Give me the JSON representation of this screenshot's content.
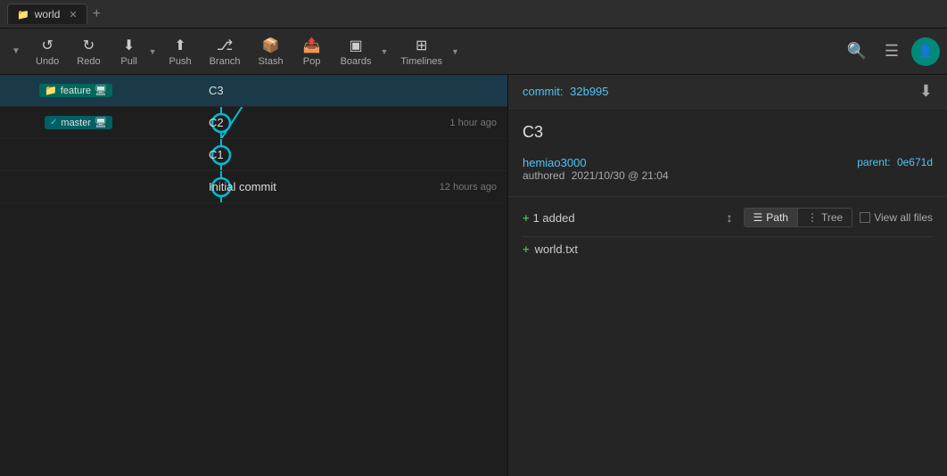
{
  "titlebar": {
    "tab_name": "world",
    "tab_icon": "📁",
    "new_tab_label": "+"
  },
  "toolbar": {
    "undo_label": "Undo",
    "redo_label": "Redo",
    "pull_label": "Pull",
    "push_label": "Push",
    "branch_label": "Branch",
    "stash_label": "Stash",
    "pop_label": "Pop",
    "boards_label": "Boards",
    "timelines_label": "Timelines"
  },
  "commits": [
    {
      "id": "c3",
      "message": "C3",
      "branch": "feature",
      "time": "",
      "selected": true
    },
    {
      "id": "c2",
      "message": "C2",
      "branch": "master",
      "time": "1 hour ago",
      "selected": false
    },
    {
      "id": "c1",
      "message": "C1",
      "branch": "",
      "time": "",
      "selected": false
    },
    {
      "id": "c0",
      "message": "Initial commit",
      "branch": "",
      "time": "12 hours ago",
      "selected": false
    }
  ],
  "commit_detail": {
    "label": "commit:",
    "hash": "32b995",
    "title": "C3",
    "author": "hemiao3000",
    "authored_label": "authored",
    "date": "2021/10/30 @ 21:04",
    "parent_label": "parent:",
    "parent_hash": "0e671d"
  },
  "files": {
    "added_count": "1 added",
    "plus_label": "+",
    "path_label": "Path",
    "tree_label": "Tree",
    "view_all_label": "View all files",
    "items": [
      {
        "name": "world.txt",
        "status": "added"
      }
    ]
  }
}
